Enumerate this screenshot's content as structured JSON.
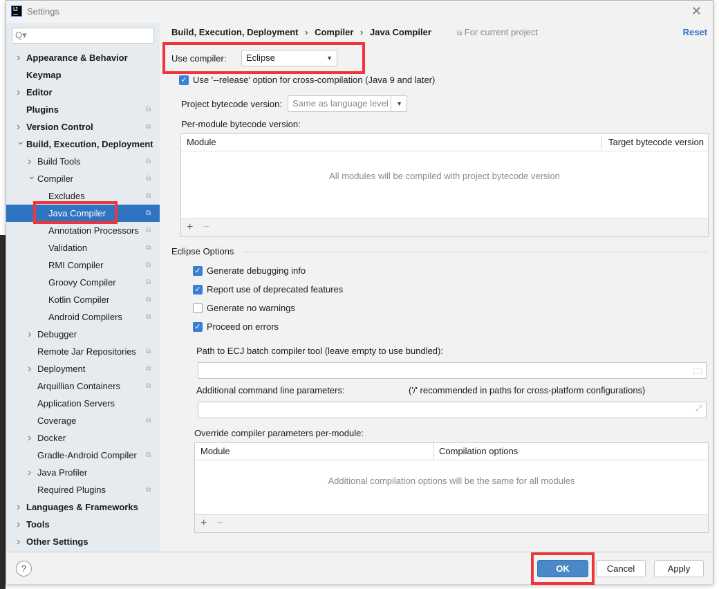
{
  "window": {
    "title": "Settings",
    "close_icon": "close-icon"
  },
  "sidebar": {
    "search_placeholder": "Q▾",
    "items": [
      {
        "label": "Appearance & Behavior",
        "level": 0,
        "arrow": true,
        "bold": true,
        "proj": false
      },
      {
        "label": "Keymap",
        "level": 0,
        "arrow": false,
        "bold": true,
        "proj": false
      },
      {
        "label": "Editor",
        "level": 0,
        "arrow": true,
        "bold": true,
        "proj": false
      },
      {
        "label": "Plugins",
        "level": 0,
        "arrow": false,
        "bold": true,
        "proj": true
      },
      {
        "label": "Version Control",
        "level": 0,
        "arrow": true,
        "bold": true,
        "proj": true
      },
      {
        "label": "Build, Execution, Deployment",
        "level": 0,
        "arrow": "open",
        "bold": true,
        "proj": false
      },
      {
        "label": "Build Tools",
        "level": 1,
        "arrow": true,
        "proj": true
      },
      {
        "label": "Compiler",
        "level": 1,
        "arrow": "open",
        "proj": true
      },
      {
        "label": "Excludes",
        "level": 2,
        "arrow": false,
        "proj": true
      },
      {
        "label": "Java Compiler",
        "level": 2,
        "arrow": false,
        "proj": true,
        "selected": true
      },
      {
        "label": "Annotation Processors",
        "level": 2,
        "arrow": false,
        "proj": true
      },
      {
        "label": "Validation",
        "level": 2,
        "arrow": false,
        "proj": true
      },
      {
        "label": "RMI Compiler",
        "level": 2,
        "arrow": false,
        "proj": true
      },
      {
        "label": "Groovy Compiler",
        "level": 2,
        "arrow": false,
        "proj": true
      },
      {
        "label": "Kotlin Compiler",
        "level": 2,
        "arrow": false,
        "proj": true
      },
      {
        "label": "Android Compilers",
        "level": 2,
        "arrow": false,
        "proj": true
      },
      {
        "label": "Debugger",
        "level": 1,
        "arrow": true,
        "proj": false
      },
      {
        "label": "Remote Jar Repositories",
        "level": 1,
        "arrow": false,
        "proj": true
      },
      {
        "label": "Deployment",
        "level": 1,
        "arrow": true,
        "proj": true
      },
      {
        "label": "Arquillian Containers",
        "level": 1,
        "arrow": false,
        "proj": true
      },
      {
        "label": "Application Servers",
        "level": 1,
        "arrow": false,
        "proj": false
      },
      {
        "label": "Coverage",
        "level": 1,
        "arrow": false,
        "proj": true
      },
      {
        "label": "Docker",
        "level": 1,
        "arrow": true,
        "proj": false
      },
      {
        "label": "Gradle-Android Compiler",
        "level": 1,
        "arrow": false,
        "proj": true
      },
      {
        "label": "Java Profiler",
        "level": 1,
        "arrow": true,
        "proj": false
      },
      {
        "label": "Required Plugins",
        "level": 1,
        "arrow": false,
        "proj": true
      },
      {
        "label": "Languages & Frameworks",
        "level": 0,
        "arrow": true,
        "bold": true,
        "proj": false
      },
      {
        "label": "Tools",
        "level": 0,
        "arrow": true,
        "bold": true,
        "proj": false
      },
      {
        "label": "Other Settings",
        "level": 0,
        "arrow": true,
        "bold": true,
        "proj": false
      }
    ]
  },
  "main": {
    "breadcrumb": [
      "Build, Execution, Deployment",
      "Compiler",
      "Java Compiler"
    ],
    "breadcrumb_sep": "›",
    "scope": "For current project",
    "reset": "Reset",
    "use_compiler_label": "Use compiler:",
    "use_compiler_value": "Eclipse",
    "release_option": {
      "label": "Use '--release' option for cross-compilation (Java 9 and later)",
      "checked": true
    },
    "bytecode_label": "Project bytecode version:",
    "bytecode_value": "Same as language level",
    "per_module_label": "Per-module bytecode version:",
    "module_table": {
      "columns": [
        "Module",
        "Target bytecode version"
      ],
      "empty": "All modules will be compiled with project bytecode version",
      "add": "+",
      "remove": "−"
    },
    "eclipse_options_title": "Eclipse Options",
    "options": [
      {
        "label": "Generate debugging info",
        "checked": true
      },
      {
        "label": "Report use of deprecated features",
        "checked": true
      },
      {
        "label": "Generate no warnings",
        "checked": false
      },
      {
        "label": "Proceed on errors",
        "checked": true
      }
    ],
    "ecj_path_label": "Path to ECJ batch compiler tool (leave empty to use bundled):",
    "ecj_path_value": "",
    "cmd_params_label": "Additional command line parameters:",
    "cmd_params_hint": "('/' recommended in paths for cross-platform configurations)",
    "cmd_params_value": "",
    "override_label": "Override compiler parameters per-module:",
    "override_table": {
      "columns": [
        "Module",
        "Compilation options"
      ],
      "empty": "Additional compilation options will be the same for all modules",
      "add": "+",
      "remove": "−"
    }
  },
  "footer": {
    "help": "?",
    "ok": "OK",
    "cancel": "Cancel",
    "apply": "Apply"
  },
  "colors": {
    "accent": "#2f74c0",
    "highlight_box": "#f0353a",
    "primary_button": "#4a88c7"
  }
}
